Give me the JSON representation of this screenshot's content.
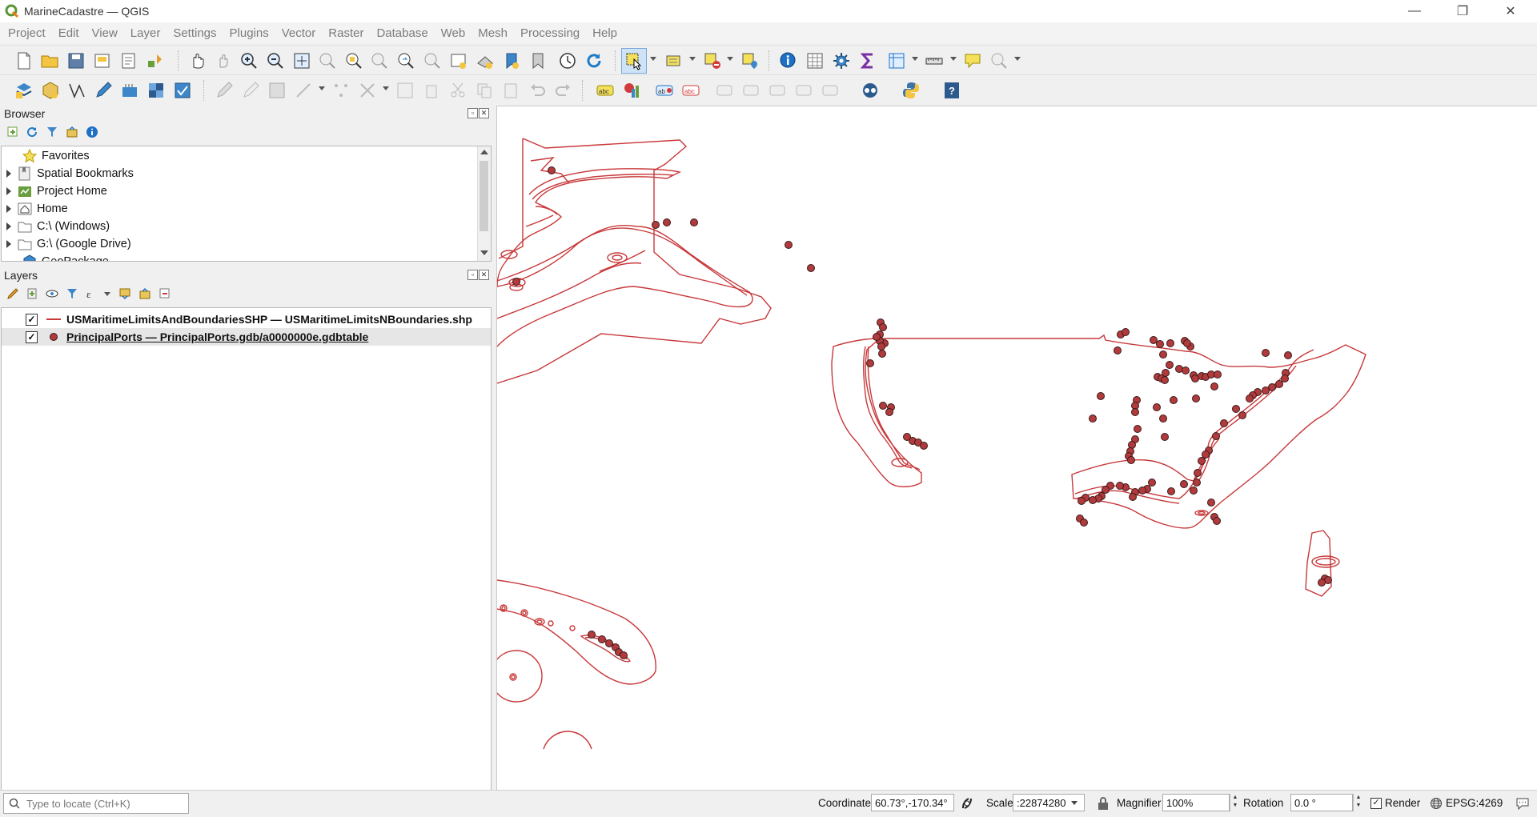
{
  "window": {
    "title": "MarineCadastre — QGIS"
  },
  "menubar": {
    "items": [
      "Project",
      "Edit",
      "View",
      "Layer",
      "Settings",
      "Plugins",
      "Vector",
      "Raster",
      "Database",
      "Web",
      "Mesh",
      "Processing",
      "Help"
    ]
  },
  "browser": {
    "title": "Browser",
    "items": [
      {
        "label": "Favorites",
        "icon": "star-icon",
        "expandable": false
      },
      {
        "label": "Spatial Bookmarks",
        "icon": "bookmark-icon",
        "expandable": true
      },
      {
        "label": "Project Home",
        "icon": "project-home-icon",
        "expandable": true
      },
      {
        "label": "Home",
        "icon": "home-icon",
        "expandable": true
      },
      {
        "label": "C:\\ (Windows)",
        "icon": "folder-icon",
        "expandable": true
      },
      {
        "label": "G:\\ (Google Drive)",
        "icon": "folder-icon",
        "expandable": true
      },
      {
        "label": "GeoPackage",
        "icon": "geopackage-icon",
        "expandable": false
      }
    ]
  },
  "layers": {
    "title": "Layers",
    "items": [
      {
        "label": "USMaritimeLimitsAndBoundariesSHP — USMaritimeLimitsNBoundaries.shp",
        "checked": true,
        "symbol": "line",
        "color": "#c8383a",
        "selected": false
      },
      {
        "label": "PrincipalPorts — PrincipalPorts.gdb/a0000000e.gdbtable",
        "checked": true,
        "symbol": "point",
        "color": "#b03a3c",
        "selected": true
      }
    ]
  },
  "statusbar": {
    "locate_placeholder": "Type to locate (Ctrl+K)",
    "coordinate_label": "Coordinate",
    "coordinate_value": "60.73°,-170.34°",
    "scale_label": "Scale",
    "scale_value": ":22874280",
    "magnifier_label": "Magnifier",
    "magnifier_value": "100%",
    "rotation_label": "Rotation",
    "rotation_value": "0.0 °",
    "render_label": "Render",
    "render_checked": true,
    "crs": "EPSG:4269"
  },
  "map": {
    "boundary_color": "#c8383a",
    "port_color": "#b03a3c",
    "port_stroke": "#3a1a1a"
  }
}
